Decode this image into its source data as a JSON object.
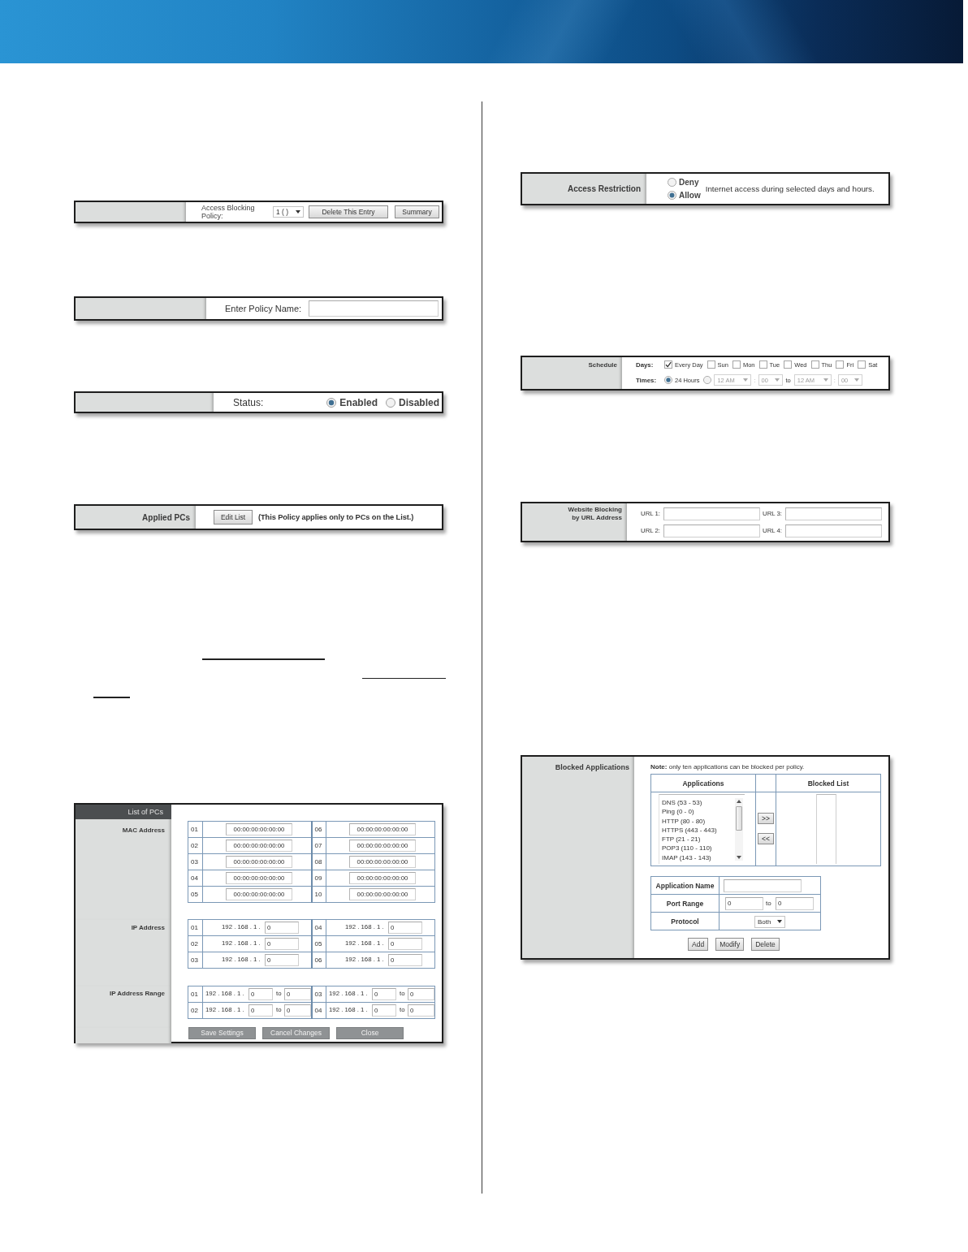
{
  "left_column": {
    "policy_panel": {
      "label": "Access Blocking Policy:",
      "policy_select": "1 ( )",
      "buttons": [
        "Delete This Entry",
        "Summary"
      ]
    },
    "name_panel": {
      "label": "Enter Policy Name:"
    },
    "status_panel": {
      "label": "Status:",
      "options": [
        {
          "label": "Enabled",
          "selected": true
        },
        {
          "label": "Disabled",
          "selected": false
        }
      ]
    },
    "applied_pcs_panel": {
      "heading": "Applied PCs",
      "button": "Edit List",
      "note": "(This Policy applies only to PCs on the List.)"
    },
    "list_of_pcs": {
      "title": "List of PCs",
      "sections": [
        {
          "kind": "mac",
          "label": "MAC Address",
          "entries": [
            {
              "number": "01",
              "value": "00:00:00:00:00:00"
            },
            {
              "number": "02",
              "value": "00:00:00:00:00:00"
            },
            {
              "number": "03",
              "value": "00:00:00:00:00:00"
            },
            {
              "number": "04",
              "value": "00:00:00:00:00:00"
            },
            {
              "number": "05",
              "value": "00:00:00:00:00:00"
            },
            {
              "number": "06",
              "value": "00:00:00:00:00:00"
            },
            {
              "number": "07",
              "value": "00:00:00:00:00:00"
            },
            {
              "number": "08",
              "value": "00:00:00:00:00:00"
            },
            {
              "number": "09",
              "value": "00:00:00:00:00:00"
            },
            {
              "number": "10",
              "value": "00:00:00:00:00:00"
            }
          ]
        },
        {
          "kind": "ip",
          "label": "IP Address",
          "entries": [
            {
              "number": "01",
              "prefix": "192 . 168 . 1 .",
              "value": "0"
            },
            {
              "number": "02",
              "prefix": "192 . 168 . 1 .",
              "value": "0"
            },
            {
              "number": "03",
              "prefix": "192 . 168 . 1 .",
              "value": "0"
            },
            {
              "number": "04",
              "prefix": "192 . 168 . 1 .",
              "value": "0"
            },
            {
              "number": "05",
              "prefix": "192 . 168 . 1 .",
              "value": "0"
            },
            {
              "number": "06",
              "prefix": "192 . 168 . 1 .",
              "value": "0"
            }
          ]
        },
        {
          "kind": "range",
          "label": "IP Address Range",
          "entries": [
            {
              "number": "01",
              "prefix": "192 . 168 . 1 .",
              "start": "0",
              "to": "to",
              "end": "0"
            },
            {
              "number": "02",
              "prefix": "192 . 168 . 1 .",
              "start": "0",
              "to": "to",
              "end": "0"
            },
            {
              "number": "03",
              "prefix": "192 . 168 . 1 .",
              "start": "0",
              "to": "to",
              "end": "0"
            },
            {
              "number": "04",
              "prefix": "192 . 168 . 1 .",
              "start": "0",
              "to": "to",
              "end": "0"
            }
          ]
        }
      ],
      "buttons": [
        "Save Settings",
        "Cancel Changes",
        "Close"
      ]
    }
  },
  "right_column": {
    "access_restriction": {
      "heading": "Access Restriction",
      "options": [
        {
          "label": "Deny",
          "selected": false
        },
        {
          "label": "Allow",
          "selected": true
        }
      ],
      "text": "Internet access during selected days and hours."
    },
    "schedule": {
      "heading": "Schedule",
      "days_label": "Days:",
      "days": [
        {
          "label": "Every Day",
          "checked": true
        },
        {
          "label": "Sun",
          "checked": false
        },
        {
          "label": "Mon",
          "checked": false
        },
        {
          "label": "Tue",
          "checked": false
        },
        {
          "label": "Wed",
          "checked": false
        },
        {
          "label": "Thu",
          "checked": false
        },
        {
          "label": "Fri",
          "checked": false
        },
        {
          "label": "Sat",
          "checked": false
        }
      ],
      "times_label": "Times:",
      "times": [
        {
          "kind": "all_day",
          "label": "24 Hours",
          "selected": true
        },
        {
          "kind": "range",
          "selected": false,
          "from_hour": "12 AM",
          "from_separator": ":",
          "from_minute": "00",
          "to": "to",
          "to_hour": "12 AM",
          "to_separator": ":",
          "to_minute": "00"
        }
      ]
    },
    "website_blocking": {
      "heading": "Website Blocking by URL Address",
      "url_fields": [
        {
          "label": "URL 1:"
        },
        {
          "label": "URL 2:"
        },
        {
          "label": "URL 3:"
        },
        {
          "label": "URL 4:"
        }
      ]
    },
    "blocked_applications": {
      "heading": "Blocked Applications",
      "note": "**Note:** only ten applications can be blocked per policy.",
      "applications_heading": "Applications",
      "applications": [
        "DNS (53 - 53)",
        "Ping (0 - 0)",
        "HTTP (80 - 80)",
        "HTTPS (443 - 443)",
        "FTP (21 - 21)",
        "POP3 (110 - 110)",
        "IMAP (143 - 143)"
      ],
      "move_buttons": [
        ">>",
        "<<"
      ],
      "blocked_list_heading": "Blocked List",
      "form": {
        "name_label": "Application Name",
        "port_label": "Port Range",
        "port_start": "0",
        "port_to": "to",
        "port_end": "0",
        "protocol_label": "Protocol",
        "protocol": "Both"
      },
      "buttons": [
        "Add",
        "Modify",
        "Delete"
      ]
    }
  }
}
